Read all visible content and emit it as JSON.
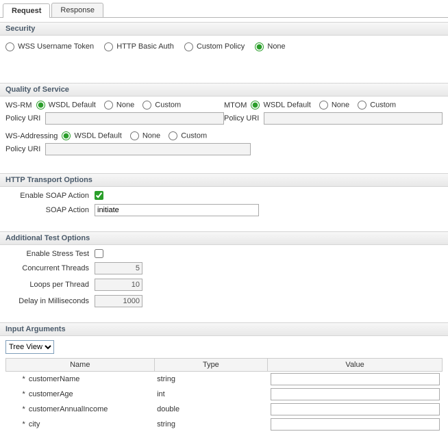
{
  "tabs": {
    "request": "Request",
    "response": "Response"
  },
  "security": {
    "header": "Security",
    "options": {
      "wss": "WSS Username Token",
      "http": "HTTP Basic Auth",
      "custom": "Custom Policy",
      "none": "None"
    }
  },
  "qos": {
    "header": "Quality of Service",
    "wsrm_label": "WS-RM",
    "mtom_label": "MTOM",
    "wsa_label": "WS-Addressing",
    "policy_label": "Policy URI",
    "opts": {
      "default": "WSDL Default",
      "none": "None",
      "custom": "Custom"
    },
    "wsrm_policy": "",
    "mtom_policy": "",
    "wsa_policy": ""
  },
  "http": {
    "header": "HTTP Transport Options",
    "enable_label": "Enable SOAP Action",
    "action_label": "SOAP Action",
    "action_value": "initiate"
  },
  "addl": {
    "header": "Additional Test Options",
    "stress_label": "Enable Stress Test",
    "threads_label": "Concurrent Threads",
    "threads_value": "5",
    "loops_label": "Loops per Thread",
    "loops_value": "10",
    "delay_label": "Delay in Milliseconds",
    "delay_value": "1000"
  },
  "args": {
    "header": "Input Arguments",
    "view_option": "Tree View",
    "cols": {
      "name": "Name",
      "type": "Type",
      "value": "Value"
    },
    "rows": [
      {
        "req": "*",
        "name": "customerName",
        "type": "string",
        "value": ""
      },
      {
        "req": "*",
        "name": "customerAge",
        "type": "int",
        "value": ""
      },
      {
        "req": "*",
        "name": "customerAnnualIncome",
        "type": "double",
        "value": ""
      },
      {
        "req": "*",
        "name": "city",
        "type": "string",
        "value": ""
      }
    ]
  }
}
